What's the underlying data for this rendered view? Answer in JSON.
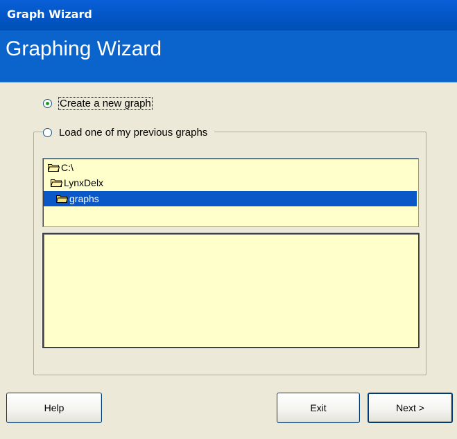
{
  "window": {
    "title": "Graph Wizard"
  },
  "header": {
    "title": "Graphing Wizard"
  },
  "options": {
    "create_new": "Create a new graph",
    "load_previous": "Load one of my previous graphs",
    "selected": "create_new"
  },
  "folder_tree": {
    "items": [
      {
        "label": "C:\\",
        "icon": "open-folder-icon",
        "selected": false
      },
      {
        "label": "LynxDelx",
        "icon": "open-folder-icon",
        "selected": false
      },
      {
        "label": "graphs",
        "icon": "open-folder-icon",
        "selected": true
      }
    ]
  },
  "file_list": {
    "items": []
  },
  "buttons": {
    "help": "Help",
    "exit": "Exit",
    "next": "Next >"
  },
  "colors": {
    "titlebar": "#0458c9",
    "header": "#0a64cc",
    "panel_background": "#ffffcc",
    "selection": "#0a58c8"
  }
}
